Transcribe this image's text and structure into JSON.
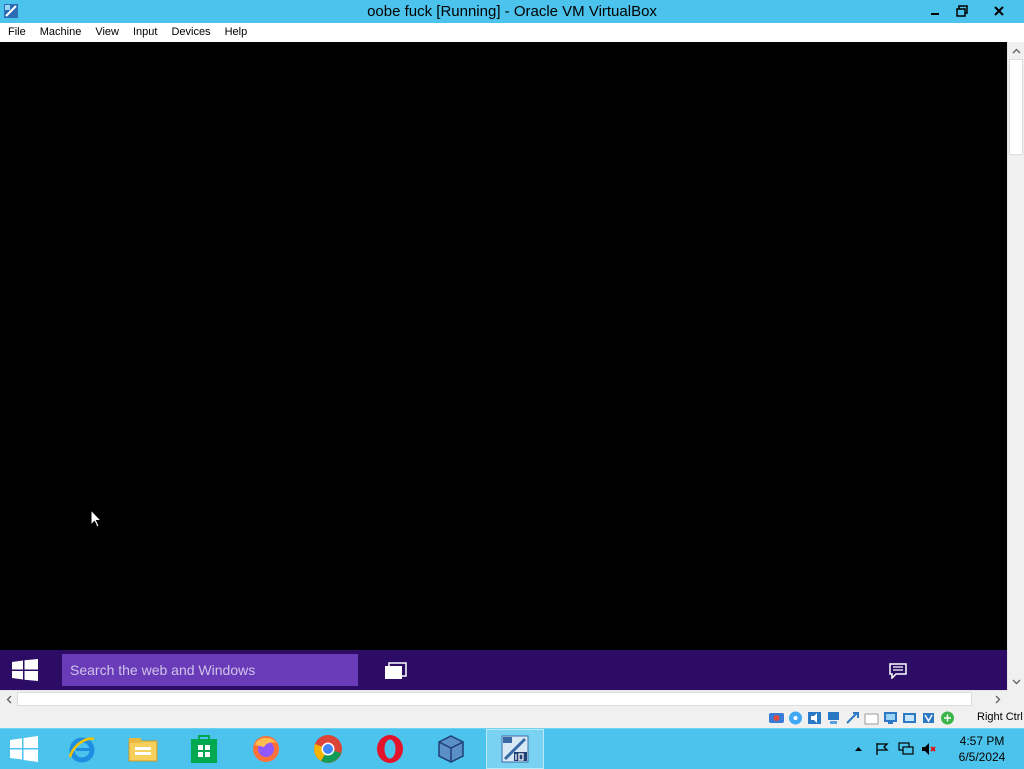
{
  "window": {
    "title": "oobe fuck [Running] - Oracle VM VirtualBox",
    "icons": {
      "app": "virtualbox-icon",
      "minimize": "minimize-icon",
      "maximize": "restore-icon",
      "close": "close-icon"
    }
  },
  "menu": {
    "items": [
      "File",
      "Machine",
      "View",
      "Input",
      "Devices",
      "Help"
    ]
  },
  "guest": {
    "search_placeholder": "Search the web and Windows",
    "colors": {
      "screen": "#000000",
      "taskbar": "#2c0c64",
      "search": "#6a3bb8"
    }
  },
  "status": {
    "host_key": "Right Ctrl",
    "icons": [
      "hard-disk-icon",
      "optical-drive-icon",
      "audio-icon",
      "network-icon",
      "usb-icon",
      "shared-folders-icon",
      "display-icon",
      "video-capture-icon",
      "processor-icon",
      "mouse-integration-icon"
    ]
  },
  "host_taskbar": {
    "apps": [
      "internet-explorer-icon",
      "file-explorer-icon",
      "store-icon",
      "firefox-icon",
      "chrome-icon",
      "opera-icon",
      "virtualbox-icon",
      "windows10-vm-icon"
    ],
    "clock": {
      "time": "4:57 PM",
      "date": "6/5/2024"
    },
    "tray": [
      "show-hidden-icons-icon",
      "action-center-flag-icon",
      "network-icon",
      "volume-muted-icon"
    ],
    "colors": {
      "bar": "#4cc3ec"
    }
  }
}
